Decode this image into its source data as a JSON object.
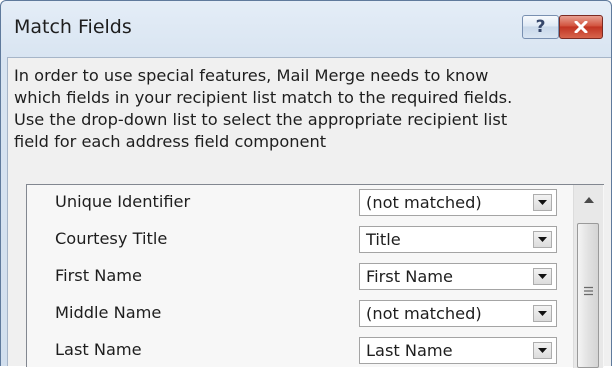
{
  "dialog": {
    "title": "Match Fields",
    "help_glyph": "?",
    "close_icon": "close-icon"
  },
  "instruction_lines": [
    "In order to use special features, Mail Merge needs to know",
    "which fields in your recipient list match to the required fields.",
    "Use the drop-down list to select the appropriate recipient list",
    "field for each address field component"
  ],
  "fields": [
    {
      "label": "Unique Identifier",
      "value": "(not matched)"
    },
    {
      "label": "Courtesy Title",
      "value": "Title"
    },
    {
      "label": "First Name",
      "value": "First Name"
    },
    {
      "label": "Middle Name",
      "value": "(not matched)"
    },
    {
      "label": "Last Name",
      "value": "Last Name"
    }
  ],
  "colors": {
    "close_button": "#c13422",
    "title_bar": "#d8e4f1",
    "dialog_body": "#f0f0f0"
  }
}
